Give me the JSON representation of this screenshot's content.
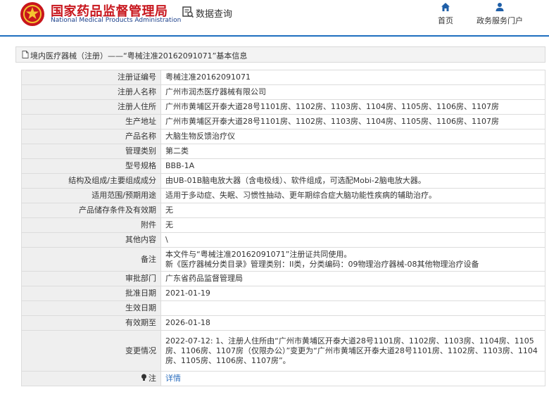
{
  "header": {
    "org_cn": "国家药品监督管理局",
    "org_en": "National Medical Products Administration",
    "data_query": "数据查询",
    "nav_home": "首页",
    "nav_service": "政务服务门户",
    "accent_color": "#1f6fbf",
    "brand_red": "#c8161d"
  },
  "breadcrumb": {
    "text": "境内医疗器械（注册）——“粤械注准20162091071”基本信息"
  },
  "rows": [
    {
      "label": "注册证编号",
      "value": "粤械注准20162091071"
    },
    {
      "label": "注册人名称",
      "value": "广州市润杰医疗器械有限公司"
    },
    {
      "label": "注册人住所",
      "value": "广州市黄埔区开泰大道28号1101房、1102房、1103房、1104房、1105房、1106房、1107房"
    },
    {
      "label": "生产地址",
      "value": "广州市黄埔区开泰大道28号1101房、1102房、1103房、1104房、1105房、1106房、1107房"
    },
    {
      "label": "产品名称",
      "value": "大脑生物反馈治疗仪"
    },
    {
      "label": "管理类别",
      "value": "第二类"
    },
    {
      "label": "型号规格",
      "value": "BBB-1A"
    },
    {
      "label": "结构及组成/主要组成成分",
      "value": "由UB-01B脑电放大器（含电极线）、软件组成，可选配Mobi-2脑电放大器。"
    },
    {
      "label": "适用范围/预期用途",
      "value": "适用于多动症、失眠、习惯性抽动、更年期综合症大脑功能性疾病的辅助治疗。"
    },
    {
      "label": "产品储存条件及有效期",
      "value": "无"
    },
    {
      "label": "附件",
      "value": "无"
    },
    {
      "label": "其他内容",
      "value": "\\"
    },
    {
      "label": "备注",
      "value": "本文件与“粤械注准20162091071”注册证共同使用。",
      "value2": "新《医疗器械分类目录》管理类别：II类，分类编码：09物理治疗器械-08其他物理治疗设备"
    },
    {
      "label": "审批部门",
      "value": "广东省药品监督管理局"
    },
    {
      "label": "批准日期",
      "value": "2021-01-19"
    },
    {
      "label": "生效日期",
      "value": ""
    },
    {
      "label": "有效期至",
      "value": "2026-01-18"
    },
    {
      "label": "变更情况",
      "value": "2022-07-12: 1、注册人住所由“广州市黄埔区开泰大道28号1101房、1102房、1103房、1104房、1105房、1106房、1107房（仅限办公）”变更为“广州市黄埔区开泰大道28号1101房、1102房、1103房、1104房、1105房、1106房、1107房”。"
    }
  ],
  "note": {
    "label": "注",
    "link": "详情",
    "link_color": "#2d6fbe"
  }
}
